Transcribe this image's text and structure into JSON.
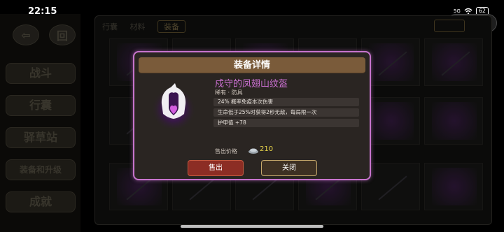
{
  "status_bar": {
    "time": "22:15",
    "network": "5G",
    "battery": "62"
  },
  "capsule": {
    "more_label": "•••"
  },
  "side_menu": {
    "top_icons": [
      "back-icon",
      "calendar-icon"
    ],
    "items": [
      {
        "label": "战斗"
      },
      {
        "label": "行囊"
      },
      {
        "label": "驿草站"
      },
      {
        "label": "装备和升级"
      },
      {
        "label": "成就"
      }
    ]
  },
  "main_panel": {
    "title": "行囊",
    "tabs": [
      "材料",
      "装备"
    ]
  },
  "modal": {
    "title": "装备详情",
    "item": {
      "name": "戍守的凤翅山纹盔",
      "rarity_type": "稀有 · 防具",
      "attributes": [
        "24% 概率免疫本次伤害",
        "生命低于25%时获得2秒无敌，每局限一次",
        "护甲值 +78"
      ],
      "icon": "helmet-icon",
      "rarity_color": "#cf72d6"
    },
    "price_label": "售出价格",
    "price_icon": "silver-icon",
    "price_value": "210",
    "buttons": {
      "sell": "售出",
      "close": "关闭"
    }
  },
  "colors": {
    "accent": "#c774cd",
    "gold": "#e6d34a"
  }
}
